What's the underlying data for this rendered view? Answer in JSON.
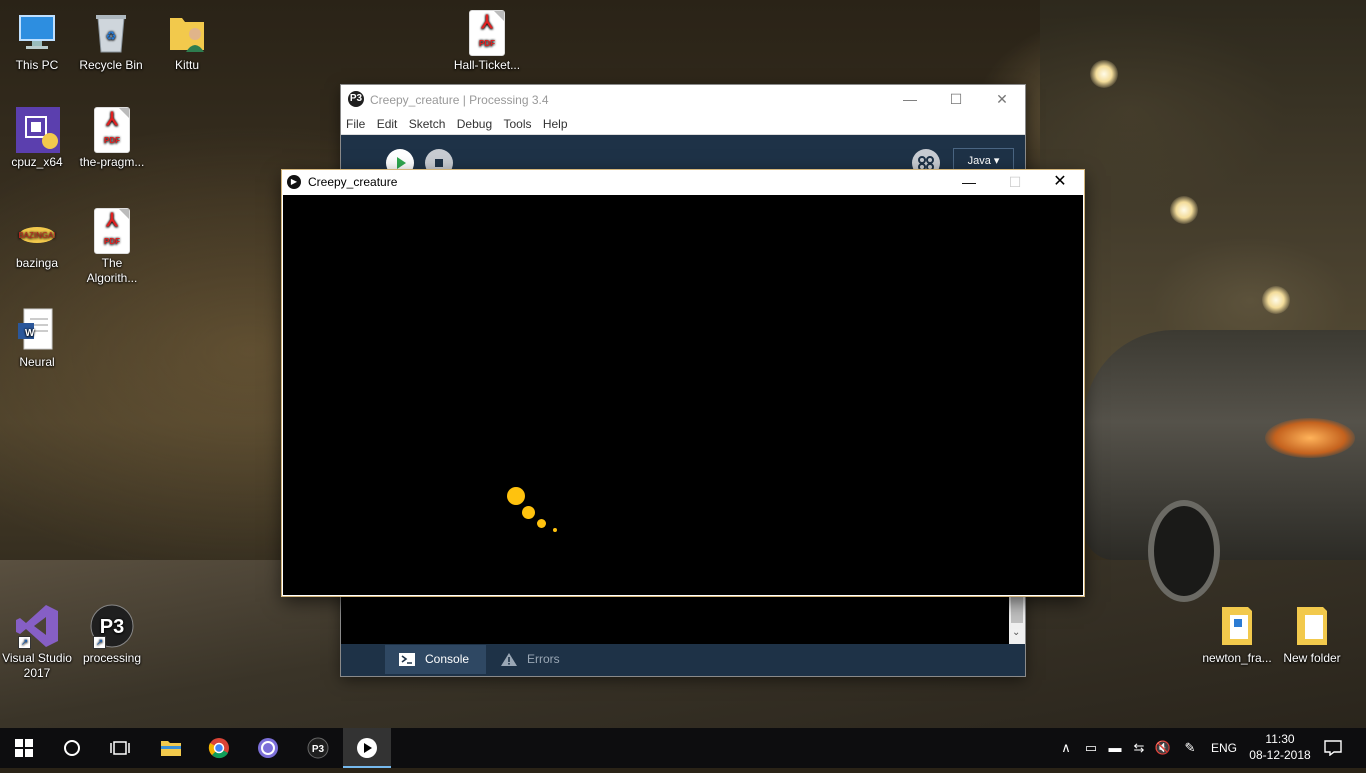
{
  "desktop": {
    "icons": [
      {
        "label": "This PC",
        "icon": "computer-icon"
      },
      {
        "label": "Recycle Bin",
        "icon": "recycle-bin-icon"
      },
      {
        "label": "Kittu",
        "icon": "user-folder-icon"
      },
      {
        "label": "Hall-Ticket...",
        "icon": "pdf-icon"
      },
      {
        "label": "cpuz_x64",
        "icon": "cpuz-icon"
      },
      {
        "label": "the-pragm...",
        "icon": "pdf-icon"
      },
      {
        "label": "bazinga",
        "icon": "bazinga-icon"
      },
      {
        "label": "The Algorith...",
        "icon": "pdf-icon"
      },
      {
        "label": "Neural",
        "icon": "word-doc-icon"
      },
      {
        "label": "Visual Studio 2017",
        "icon": "visual-studio-icon"
      },
      {
        "label": "processing",
        "icon": "processing-icon"
      },
      {
        "label": "newton_fra...",
        "icon": "folder-icon"
      },
      {
        "label": "New folder",
        "icon": "folder-icon"
      }
    ],
    "pdf_badge": "PDF",
    "word_badge": "W"
  },
  "ide": {
    "title": "Creepy_creature | Processing 3.4",
    "logo": "P3",
    "menu": [
      "File",
      "Edit",
      "Sketch",
      "Debug",
      "Tools",
      "Help"
    ],
    "mode": "Java ▾",
    "tabs": {
      "console": "Console",
      "errors": "Errors"
    }
  },
  "sketch": {
    "title": "Creepy_creature",
    "dot_color": "#ffc20e",
    "dots": [
      {
        "d": 18
      },
      {
        "d": 13
      },
      {
        "d": 9
      },
      {
        "d": 4
      }
    ]
  },
  "taskbar": {
    "apps": [
      "start",
      "search",
      "task-view",
      "file-explorer",
      "chrome",
      "bittorrent",
      "processing",
      "sketch-window"
    ],
    "tray": {
      "language": "ENG"
    },
    "clock": {
      "time": "11:30",
      "date": "08-12-2018"
    }
  },
  "colors": {
    "ide_toolbar": "#1e3247",
    "taskbar": "#0d0d0f",
    "accent": "#76b9ed"
  }
}
